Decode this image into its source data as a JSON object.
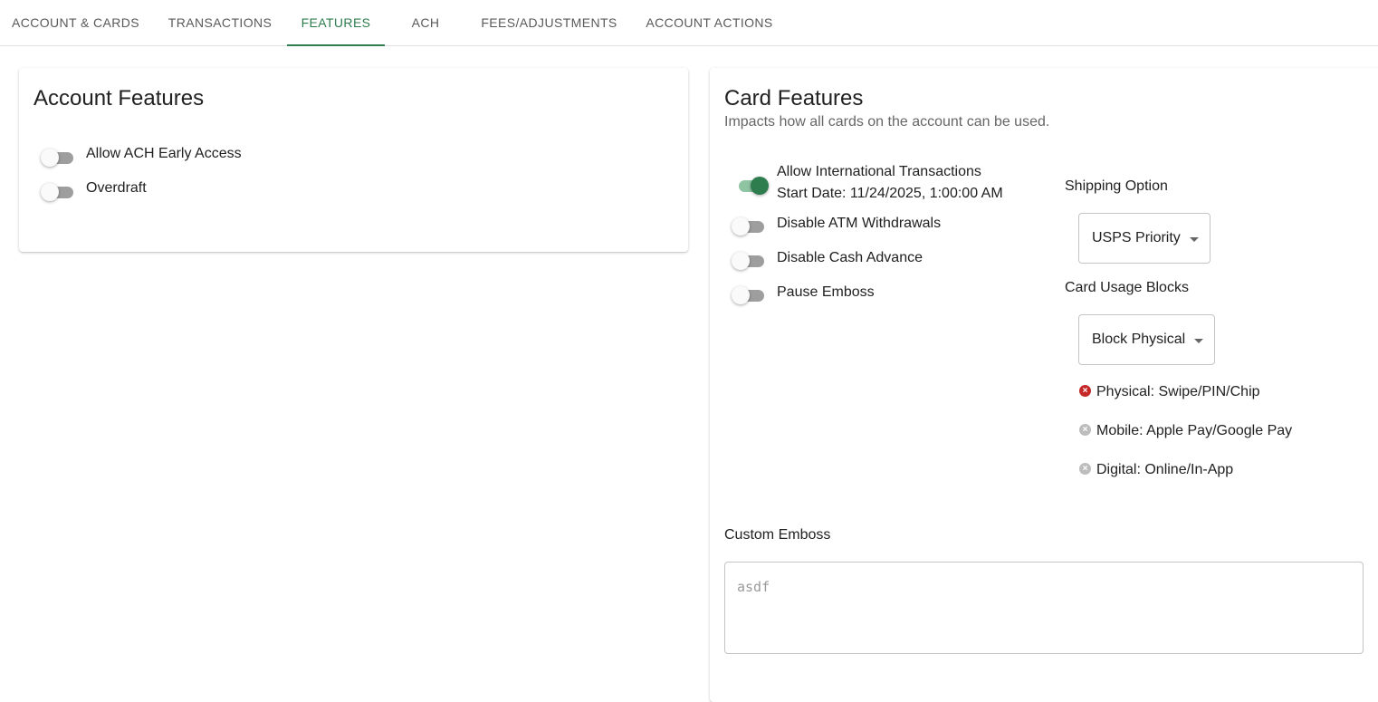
{
  "tabs": [
    {
      "label": "ACCOUNT & CARDS",
      "active": false
    },
    {
      "label": "TRANSACTIONS",
      "active": false
    },
    {
      "label": "FEATURES",
      "active": true
    },
    {
      "label": "ACH",
      "active": false
    },
    {
      "label": "FEES/ADJUSTMENTS",
      "active": false
    },
    {
      "label": "ACCOUNT ACTIONS",
      "active": false
    }
  ],
  "account_features": {
    "title": "Account Features",
    "toggles": [
      {
        "label": "Allow ACH Early Access",
        "on": false
      },
      {
        "label": "Overdraft",
        "on": false
      }
    ]
  },
  "card_features": {
    "title": "Card Features",
    "subtitle": "Impacts how all cards on the account can be used.",
    "toggles": [
      {
        "label": "Allow International Transactions",
        "sublabel": "Start Date: 11/24/2025, 1:00:00 AM",
        "on": true
      },
      {
        "label": "Disable ATM Withdrawals",
        "on": false
      },
      {
        "label": "Disable Cash Advance",
        "on": false
      },
      {
        "label": "Pause Emboss",
        "on": false
      }
    ],
    "shipping": {
      "label": "Shipping Option",
      "value": "USPS Priority"
    },
    "usage_blocks": {
      "label": "Card Usage Blocks",
      "value": "Block Physical",
      "items": [
        {
          "label": "Physical: Swipe/PIN/Chip",
          "blocked": true
        },
        {
          "label": "Mobile: Apple Pay/Google Pay",
          "blocked": false
        },
        {
          "label": "Digital: Online/In-App",
          "blocked": false
        }
      ]
    },
    "custom_emboss": {
      "label": "Custom Emboss",
      "placeholder": "asdf"
    }
  },
  "colors": {
    "accent": "#2e7d4f",
    "blocked_icon": "#c62828",
    "unblocked_icon": "#bdbdbd"
  },
  "icons": {
    "block_item": "x-circle-icon",
    "select_arrow": "caret-down-icon"
  }
}
